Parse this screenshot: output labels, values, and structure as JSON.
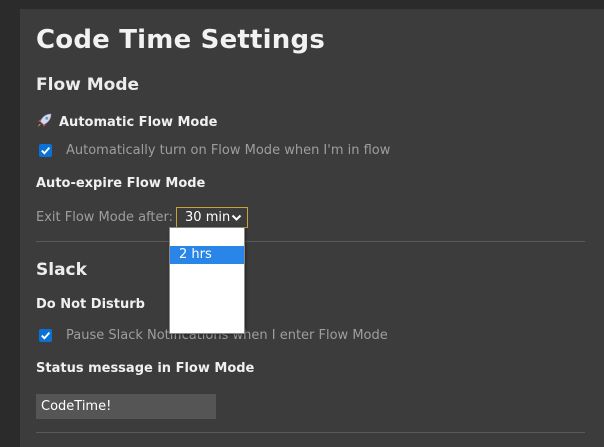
{
  "title": "Code Time Settings",
  "flow_mode": {
    "heading": "Flow Mode",
    "automatic_label": "Automatic Flow Mode",
    "automatic_icon": "rocket-icon",
    "auto_turn_on_checkbox": {
      "label": "Automatically turn on Flow Mode when I'm in flow",
      "checked": true
    },
    "auto_expire_heading": "Auto-expire Flow Mode",
    "exit_label": "Exit Flow Mode after:",
    "exit_select": {
      "value": "30 min",
      "options": [
        "",
        "2 hrs",
        "",
        "",
        ""
      ],
      "highlighted_option": "2 hrs"
    }
  },
  "slack": {
    "heading": "Slack",
    "dnd_heading": "Do Not Disturb",
    "pause_checkbox": {
      "label": "Pause Slack Notifications when I enter Flow Mode",
      "checked": true
    },
    "status_heading": "Status message in Flow Mode",
    "status_input_value": "CodeTime!"
  },
  "colors": {
    "background": "#2b2b2b",
    "panel": "#3c3c3c",
    "checkbox_accent": "#0a72d6",
    "select_border": "#c7a33c",
    "option_highlight": "#2a85e8"
  }
}
